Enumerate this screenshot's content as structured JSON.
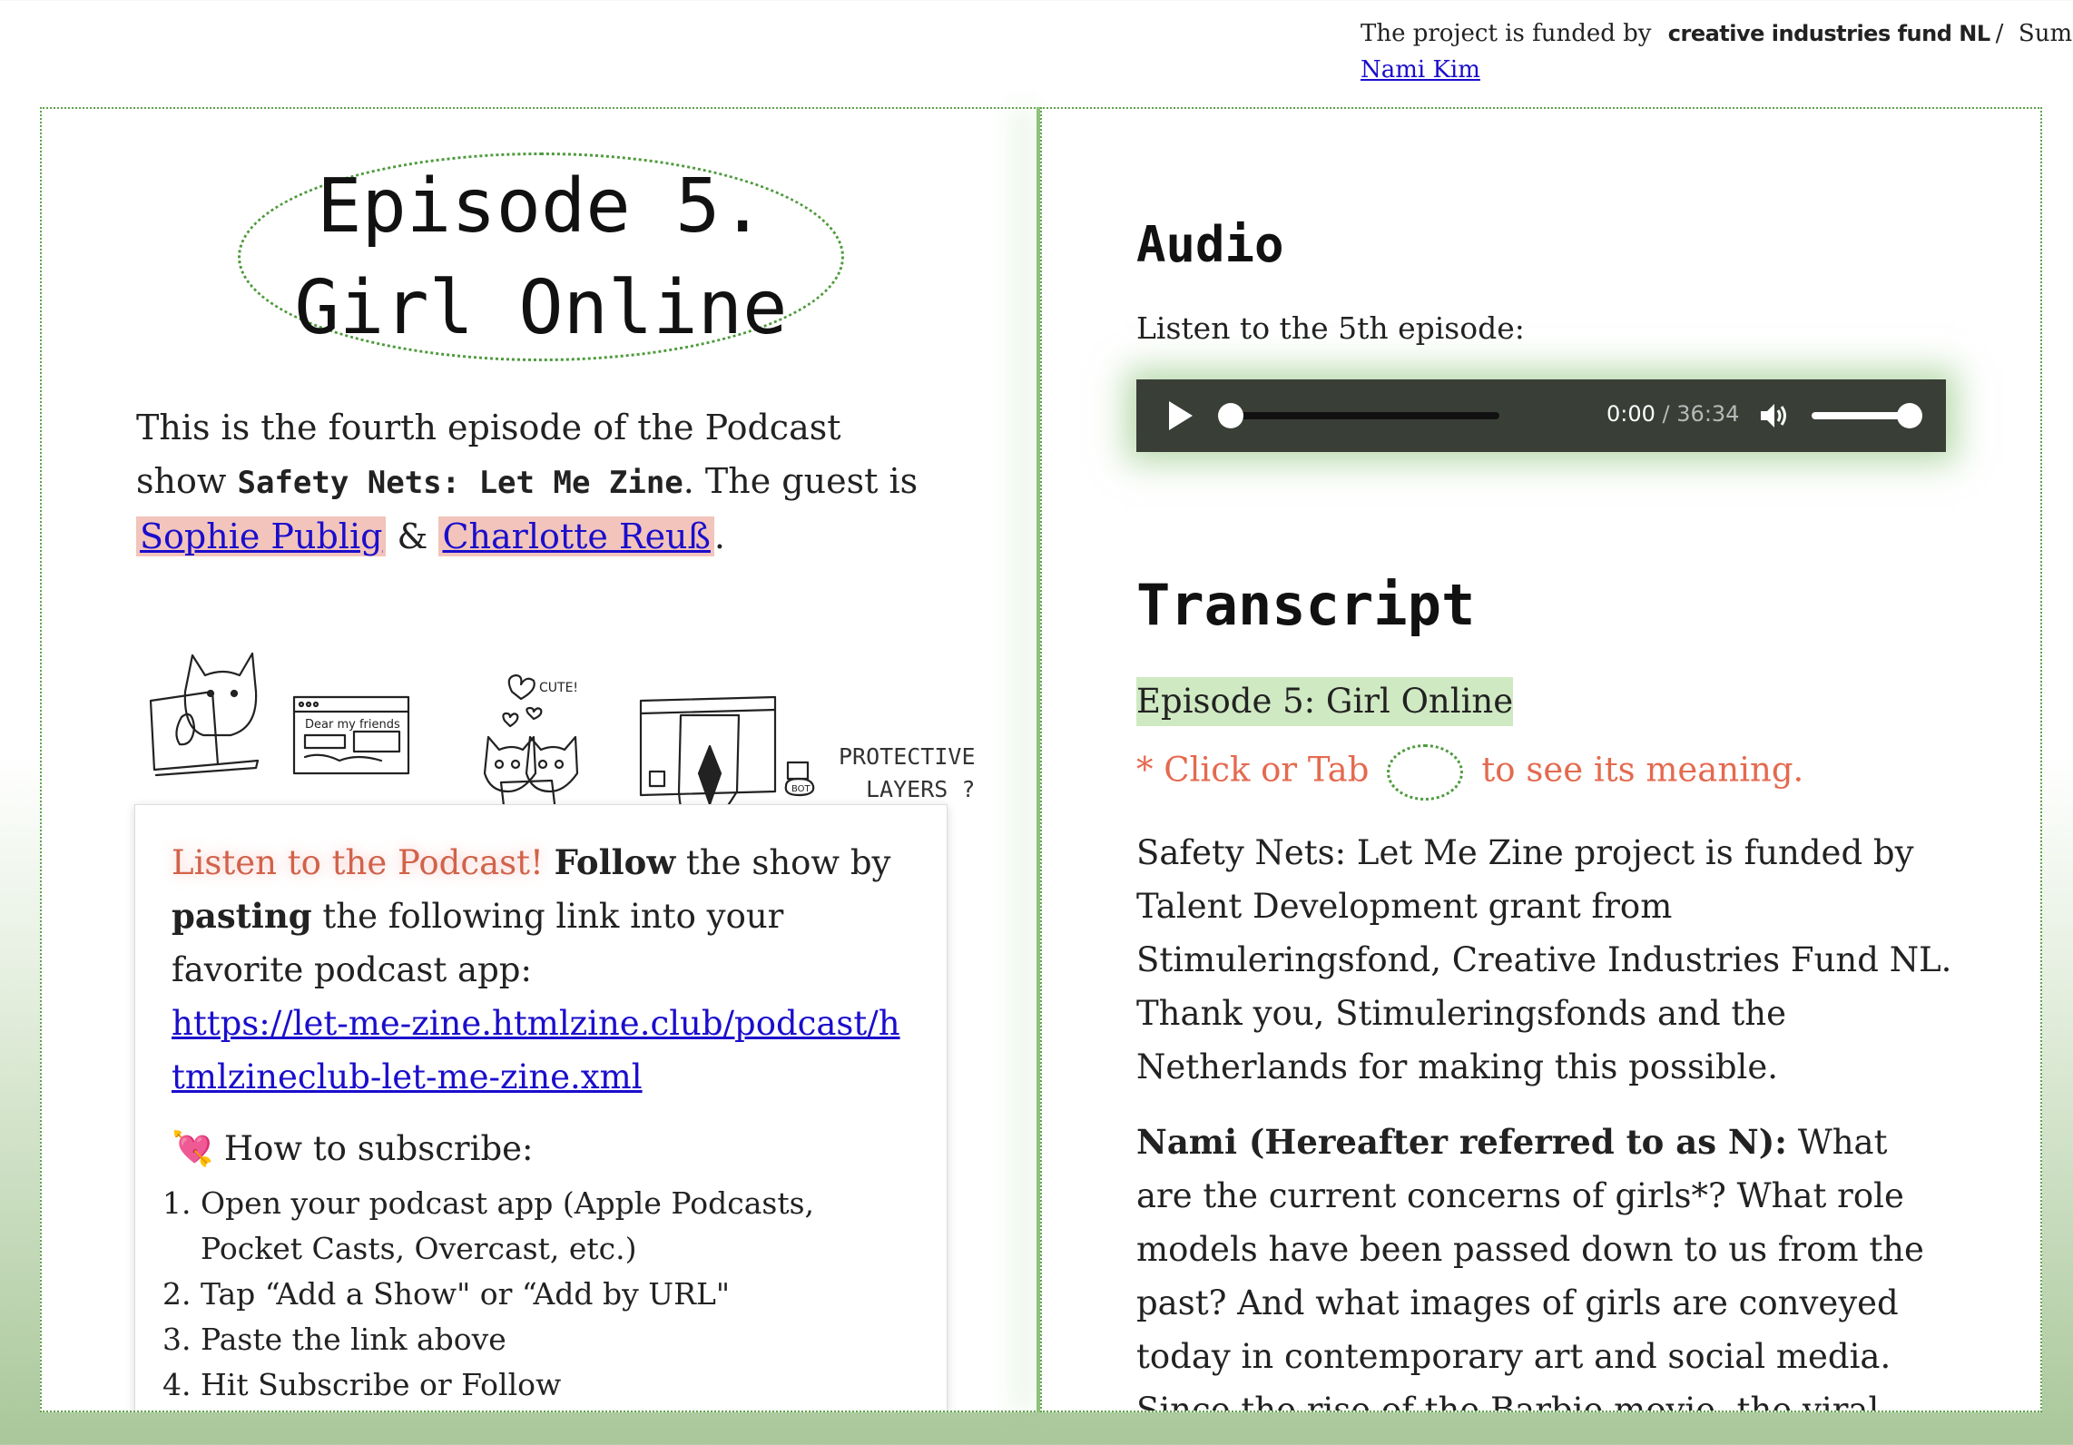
{
  "topbar": {
    "funded_text": "The project is funded by",
    "fund_name": "creative industries fund NL",
    "separator": "/",
    "summary_label": "Summary:",
    "author_link": "Nami Kim"
  },
  "left": {
    "title_line1": "Episode 5.",
    "title_line2": "Girl Online",
    "intro_pre": "This is the fourth episode of the Podcast show",
    "show_name": "Safety Nets: Let Me Zine",
    "intro_mid": ". The guest is",
    "guest1": "Sophie Publig",
    "amp": "&",
    "guest2": "Charlotte Reuß",
    "period": ".",
    "doodles": {
      "dear_text": "Dear my friends",
      "cute_text": "CUTE!",
      "protective_line1": "PROTECTIVE",
      "protective_line2": "LAYERS ?",
      "bot_text": "BOT"
    },
    "subscribe": {
      "listen_text": "Listen to the Podcast!",
      "follow_word": "Follow",
      "follow_rest": "the show by",
      "pasting_word": "pasting",
      "pasting_rest": "the following link into your favorite podcast app:",
      "feed_url": "https://let-me-zine.htmlzine.club/podcast/htmlzineclub-let-me-zine.xml",
      "howto_emoji": "💘",
      "howto_label": "How to subscribe:",
      "steps": [
        "Open your podcast app (Apple Podcasts, Pocket Casts, Overcast, etc.)",
        "Tap “Add a Show\" or “Add by URL\"",
        "Paste the link above",
        "Hit Subscribe or Follow"
      ]
    }
  },
  "right": {
    "audio_heading": "Audio",
    "listen_label": "Listen to the 5th episode:",
    "player": {
      "current_time": "0:00",
      "time_separator": "/",
      "duration": "36:34",
      "progress_fraction": 0,
      "volume_fraction": 1.0
    },
    "transcript_heading": "Transcript",
    "episode_label": "Episode 5: Girl Online",
    "hint_pre": "* Click or Tab",
    "hint_post": "to see its meaning.",
    "para1": "Safety Nets: Let Me Zine project is funded by Talent Development grant from Stimuleringsfond, Creative Industries Fund NL. Thank you, Stimuleringsfonds and the Netherlands for making this possible.",
    "speaker": "Nami (Hereafter referred to as N):",
    "para2": "What are the current concerns of girls*? What role models have been passed down to us from the past? And what images of girls are conveyed today in contemporary art and social media. Since the rise of the Barbie movie, the viral #girldinner trend"
  },
  "colors": {
    "accent_green": "#5fa34c",
    "salmon": "#e46a4f",
    "link_blue": "#1a0dcc",
    "guest_highlight": "#f2c4bb",
    "episode_highlight": "#cfe9c2",
    "player_bg": "#393f36"
  }
}
